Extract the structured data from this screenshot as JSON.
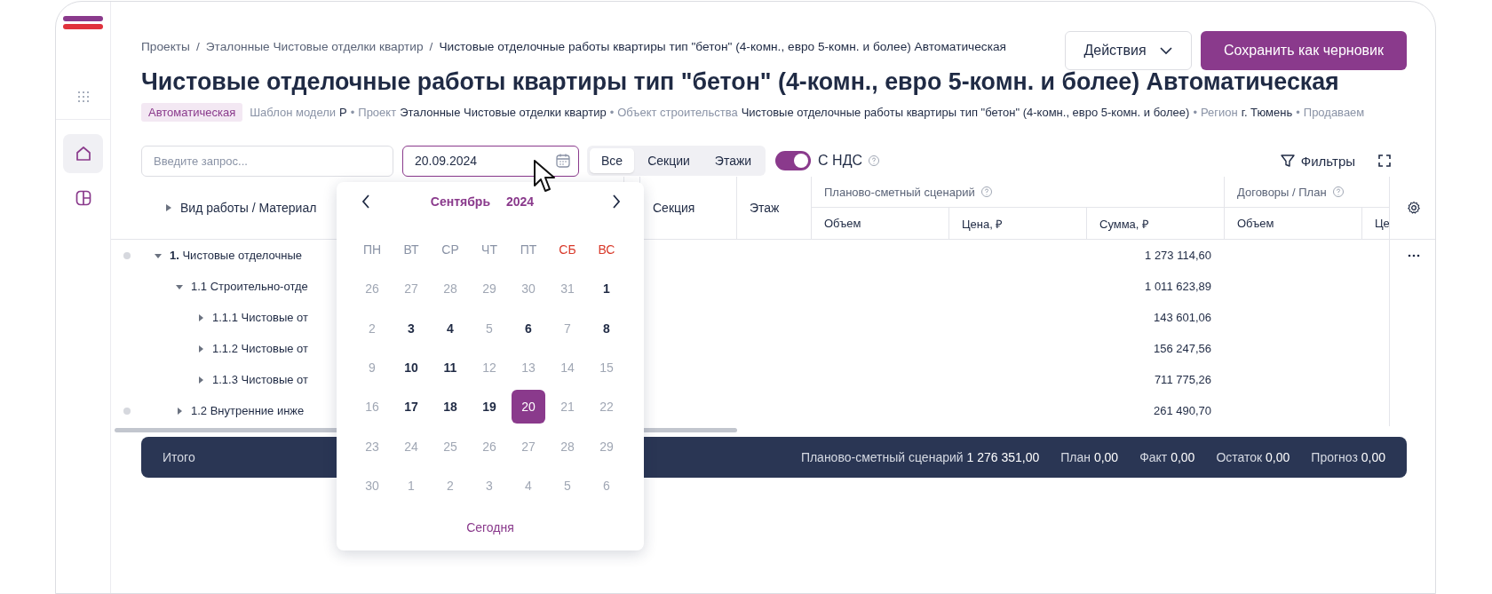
{
  "sidebar": {
    "items": [
      {
        "kind": "apps",
        "selected": false
      },
      {
        "kind": "home",
        "selected": true
      },
      {
        "kind": "panels",
        "selected": false
      }
    ]
  },
  "breadcrumbs": {
    "separator": "/",
    "items": [
      "Проекты",
      "Эталонные Чистовые отделки квартир",
      "Чистовые отделочные работы квартиры тип \"бетон\" (4-комн., евро 5-комн. и более) Автоматическая"
    ]
  },
  "actions": {
    "menu": "Действия",
    "primary": "Сохранить как черновик"
  },
  "title": "Чистовые отделочные работы квартиры тип \"бетон\" (4-комн., евро 5-комн. и более) Автоматическая",
  "meta": {
    "badge": "Автоматическая",
    "bullet": "•",
    "items": [
      {
        "label": "Шаблон модели",
        "value": "Р"
      },
      {
        "label": "Проект",
        "value": "Эталонные Чистовые отделки квартир"
      },
      {
        "label": "Объект строительства",
        "value": "Чистовые отделочные работы квартиры тип \"бетон\" (4-комн., евро 5-комн. и более)"
      },
      {
        "label": "Регион",
        "value": "г. Тюмень"
      },
      {
        "label": "Продаваем"
      }
    ]
  },
  "toolbar": {
    "search": {
      "placeholder": "Введите запрос..."
    },
    "date": {
      "value": "20.09.2024"
    },
    "segments": [
      {
        "label": "Все",
        "selected": true
      },
      {
        "label": "Секции",
        "selected": false
      },
      {
        "label": "Этажи",
        "selected": false
      }
    ],
    "vat": {
      "label": "С НДС",
      "on": true
    },
    "filters": "Фильтры"
  },
  "table": {
    "tree_header": "Вид работы / Материал",
    "columns": [
      "Секция",
      "Этаж"
    ],
    "groups": [
      {
        "label": "Планово-сметный сценарий",
        "columns": [
          "Объем",
          "Цена, ₽",
          "Сумма, ₽"
        ]
      },
      {
        "label": "Договоры / План",
        "columns": [
          "Объем",
          "Це"
        ]
      }
    ],
    "rows": [
      {
        "label": "**1.** Чистовые отделочные",
        "sum": "1 273 114,60",
        "marked": true,
        "menu": true,
        "expanded": true,
        "children": [
          {
            "label": "1.1 Строительно-отде",
            "sum": "1 011 623,89",
            "marked": false,
            "menu": false,
            "expanded": true,
            "children": [
              {
                "label": "1.1.1 Чистовые от",
                "sum": "143 601,06",
                "marked": false,
                "menu": false,
                "expanded": false
              },
              {
                "label": "1.1.2 Чистовые от",
                "sum": "156 247,56",
                "marked": false,
                "menu": false,
                "expanded": false
              },
              {
                "label": "1.1.3 Чистовые от",
                "sum": "711 775,26",
                "marked": false,
                "menu": false,
                "expanded": false
              }
            ]
          },
          {
            "label": "1.2 Внутренние инже",
            "sum": "261 490,70",
            "marked": true,
            "menu": false,
            "expanded": false
          }
        ]
      }
    ]
  },
  "totals": {
    "label": "Итого",
    "items": [
      {
        "label": "Планово-сметный сценарий",
        "value": "1 276 351,00"
      },
      {
        "label": "План",
        "value": "0,00"
      },
      {
        "label": "Факт",
        "value": "0,00"
      },
      {
        "label": "Остаток",
        "value": "0,00"
      },
      {
        "label": "Прогноз",
        "value": "0,00"
      }
    ]
  },
  "calendar": {
    "month": "Сентябрь",
    "year": "2024",
    "today": "Сегодня",
    "weekdays": [
      {
        "label": "ПН",
        "weekend": false
      },
      {
        "label": "ВТ",
        "weekend": false
      },
      {
        "label": "СР",
        "weekend": false
      },
      {
        "label": "ЧТ",
        "weekend": false
      },
      {
        "label": "ПТ",
        "weekend": false
      },
      {
        "label": "СБ",
        "weekend": true
      },
      {
        "label": "ВС",
        "weekend": true
      }
    ],
    "days": [
      {
        "label": "26",
        "available": false,
        "selected": false
      },
      {
        "label": "27",
        "available": false,
        "selected": false
      },
      {
        "label": "28",
        "available": false,
        "selected": false
      },
      {
        "label": "29",
        "available": false,
        "selected": false
      },
      {
        "label": "30",
        "available": false,
        "selected": false
      },
      {
        "label": "31",
        "available": false,
        "selected": false
      },
      {
        "label": "1",
        "available": true,
        "selected": false
      },
      {
        "label": "2",
        "available": false,
        "selected": false
      },
      {
        "label": "3",
        "available": true,
        "selected": false
      },
      {
        "label": "4",
        "available": true,
        "selected": false
      },
      {
        "label": "5",
        "available": false,
        "selected": false
      },
      {
        "label": "6",
        "available": true,
        "selected": false
      },
      {
        "label": "7",
        "available": false,
        "selected": false
      },
      {
        "label": "8",
        "available": true,
        "selected": false
      },
      {
        "label": "9",
        "available": false,
        "selected": false
      },
      {
        "label": "10",
        "available": true,
        "selected": false
      },
      {
        "label": "11",
        "available": true,
        "selected": false
      },
      {
        "label": "12",
        "available": false,
        "selected": false
      },
      {
        "label": "13",
        "available": false,
        "selected": false
      },
      {
        "label": "14",
        "available": false,
        "selected": false
      },
      {
        "label": "15",
        "available": false,
        "selected": false
      },
      {
        "label": "16",
        "available": false,
        "selected": false
      },
      {
        "label": "17",
        "available": true,
        "selected": false
      },
      {
        "label": "18",
        "available": true,
        "selected": false
      },
      {
        "label": "19",
        "available": true,
        "selected": false
      },
      {
        "label": "20",
        "available": true,
        "selected": true
      },
      {
        "label": "21",
        "available": false,
        "selected": false
      },
      {
        "label": "22",
        "available": false,
        "selected": false
      },
      {
        "label": "23",
        "available": false,
        "selected": false
      },
      {
        "label": "24",
        "available": false,
        "selected": false
      },
      {
        "label": "25",
        "available": false,
        "selected": false
      },
      {
        "label": "26",
        "available": false,
        "selected": false
      },
      {
        "label": "27",
        "available": false,
        "selected": false
      },
      {
        "label": "28",
        "available": false,
        "selected": false
      },
      {
        "label": "29",
        "available": false,
        "selected": false
      },
      {
        "label": "30",
        "available": false,
        "selected": false
      },
      {
        "label": "1",
        "available": false,
        "selected": false
      },
      {
        "label": "2",
        "available": false,
        "selected": false
      },
      {
        "label": "3",
        "available": false,
        "selected": false
      },
      {
        "label": "4",
        "available": false,
        "selected": false
      },
      {
        "label": "5",
        "available": false,
        "selected": false
      },
      {
        "label": "6",
        "available": false,
        "selected": false
      }
    ]
  }
}
